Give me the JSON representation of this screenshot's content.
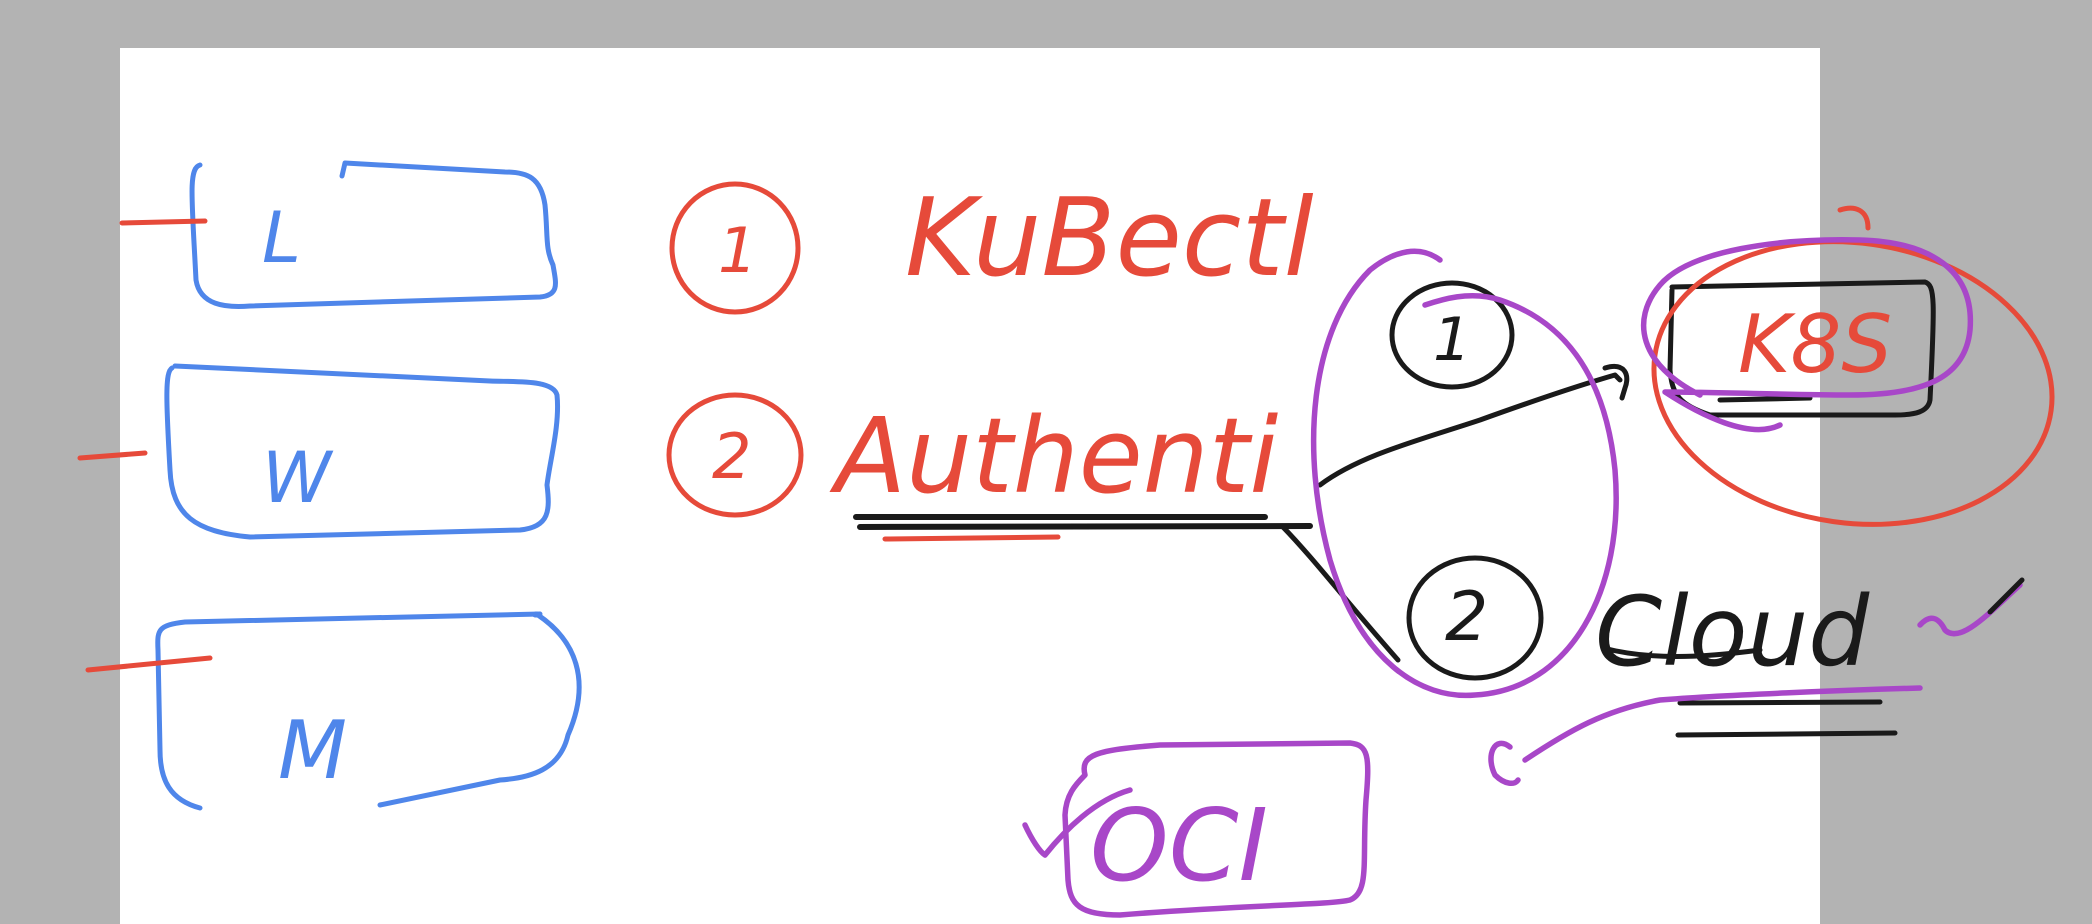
{
  "colors": {
    "canvas_background": "#b3b3b3",
    "board_background": "#ffffff",
    "blue_ink": "#4f86ea",
    "red_ink": "#e64a3a",
    "black_ink": "#1a1a1a",
    "purple_ink": "#a847c8"
  },
  "left_column": {
    "boxes": [
      {
        "label": "L"
      },
      {
        "label": "W"
      },
      {
        "label": "M"
      }
    ]
  },
  "steps": [
    {
      "number": "1",
      "text": "KuBectl"
    },
    {
      "number": "2",
      "text": "Authenti"
    }
  ],
  "branch": {
    "options": [
      {
        "number": "1"
      },
      {
        "number": "2"
      }
    ],
    "target_box": "K8S",
    "cloud_label": "Cloud",
    "bottom_box": "OCI"
  }
}
